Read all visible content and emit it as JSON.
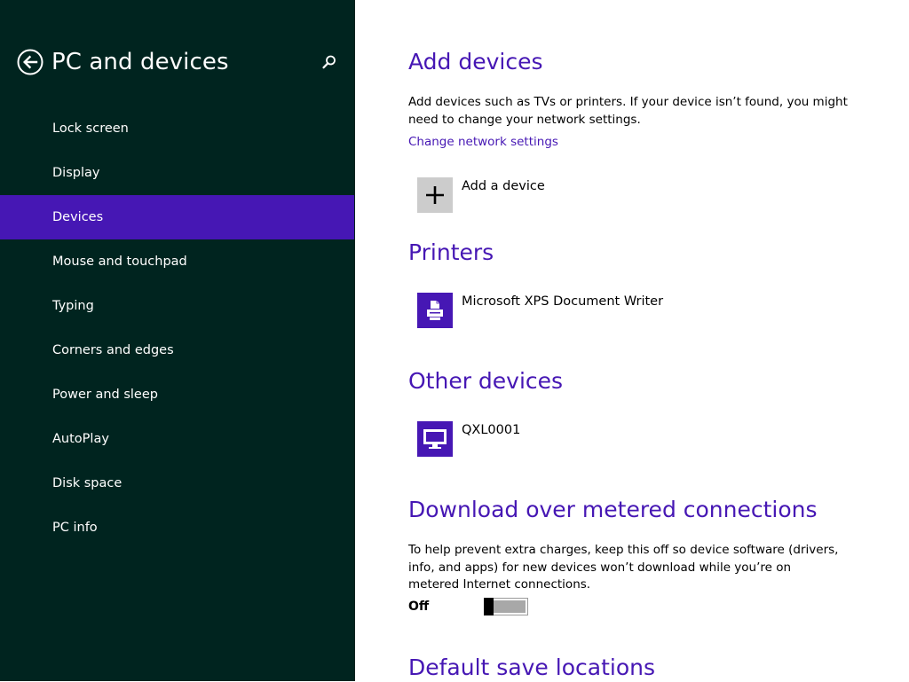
{
  "sidebar": {
    "title": "PC and devices",
    "back_icon": "back-arrow-icon",
    "search_icon": "search-icon",
    "items": [
      {
        "label": "Lock screen",
        "selected": false
      },
      {
        "label": "Display",
        "selected": false
      },
      {
        "label": "Devices",
        "selected": true
      },
      {
        "label": "Mouse and touchpad",
        "selected": false
      },
      {
        "label": "Typing",
        "selected": false
      },
      {
        "label": "Corners and edges",
        "selected": false
      },
      {
        "label": "Power and sleep",
        "selected": false
      },
      {
        "label": "AutoPlay",
        "selected": false
      },
      {
        "label": "Disk space",
        "selected": false
      },
      {
        "label": "PC info",
        "selected": false
      }
    ]
  },
  "main": {
    "add_devices": {
      "title": "Add devices",
      "description": "Add devices such as TVs or printers. If your device isn’t found, you might need to change your network settings.",
      "link": "Change network settings",
      "add_button_label": "Add a device"
    },
    "printers": {
      "title": "Printers",
      "items": [
        {
          "name": "Microsoft XPS Document Writer",
          "icon": "printer-icon"
        }
      ]
    },
    "other_devices": {
      "title": "Other devices",
      "items": [
        {
          "name": "QXL0001",
          "icon": "monitor-icon"
        }
      ]
    },
    "metered": {
      "title": "Download over metered connections",
      "description": "To help prevent extra charges, keep this off so device software (drivers, info, and apps) for new devices won’t download while you’re on metered Internet connections.",
      "toggle_label": "Off",
      "toggle_on": false
    },
    "default_save": {
      "title": "Default save locations"
    }
  },
  "colors": {
    "sidebar_bg": "#00241f",
    "accent": "#4617b4",
    "tile_gray": "#cccccc"
  }
}
